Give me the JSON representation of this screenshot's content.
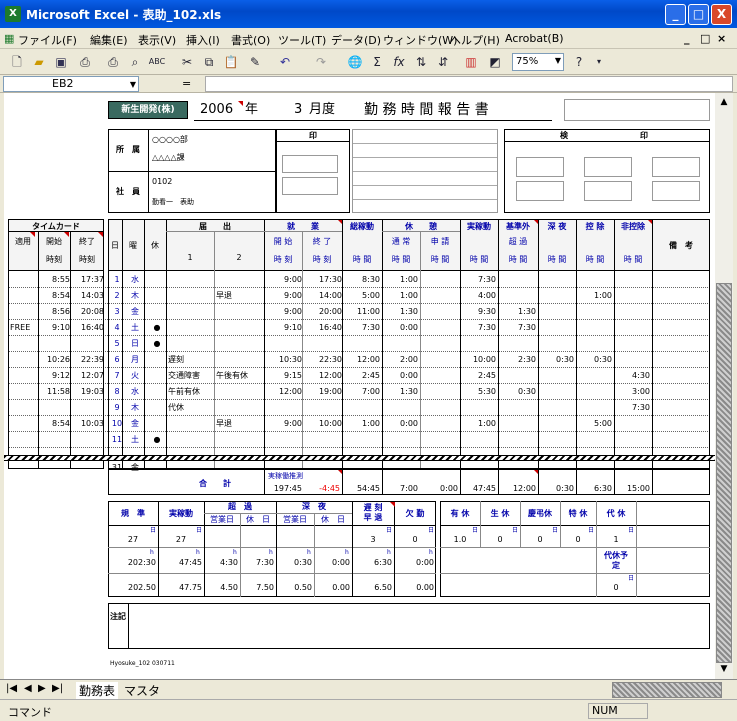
{
  "window": {
    "title": "Microsoft Excel - 表助_102.xls",
    "app_icon": "excel-icon",
    "minimize": "_",
    "maximize": "□",
    "close": "X"
  },
  "menu": [
    "ファイル(F)",
    "編集(E)",
    "表示(V)",
    "挿入(I)",
    "書式(O)",
    "ツール(T)",
    "データ(D)",
    "ウィンドウ(W)",
    "ヘルプ(H)",
    "Acrobat(B)"
  ],
  "doc_controls": {
    "minimize": "_",
    "restore": "□",
    "close": "×"
  },
  "toolbar": {
    "zoom": "75%",
    "sigma": "Σ",
    "fx": "fx",
    "help": "?"
  },
  "formula_bar": {
    "name_box": "EB2",
    "equals": "=",
    "formula": ""
  },
  "report": {
    "company": "新生開発(株)",
    "year": "2006",
    "year_unit": "年",
    "month": "3",
    "month_unit": "月度",
    "title": "勤 務 時 間 報 告 書",
    "dept_label": "所　属",
    "dept1": "○○○○部",
    "dept2": "△△△△課",
    "emp_label": "社　員",
    "emp_no": "0102",
    "emp_name": "勤看一　表助",
    "seal_label": "印",
    "approval_left": "検",
    "approval_right": "印"
  },
  "headers": {
    "timecard": "タイムカード",
    "tc_use": "適用",
    "tc_start": "開始",
    "tc_end": "終了",
    "tc_time": "時刻",
    "day": "日",
    "weekday": "曜",
    "holiday": "休",
    "todoke": "届　　出",
    "todoke1": "1",
    "todoke2": "2",
    "shugyo": "就　　業",
    "start": "開 始",
    "end": "終 了",
    "jikoku": "時 刻",
    "sorokin": "総稼動",
    "kyukei": "休　　憩",
    "tsujo": "通 常",
    "shinsei": "申 請",
    "jisshitsu": "実稼動",
    "kijungai": "基準外",
    "choka": "超 過",
    "shinya": "深 夜",
    "kojo": "控 除",
    "hikojo": "非控除",
    "jikan": "時 間",
    "biko": "備　考"
  },
  "rows": [
    {
      "tc_use": "",
      "tc_start": "8:55",
      "tc_end": "17:37",
      "day": "1",
      "wd": "水",
      "hol": "",
      "t1": "",
      "t2": "",
      "start": "9:00",
      "end": "17:30",
      "total": "8:30",
      "rest": "1:00",
      "req": "",
      "actual": "7:30",
      "over": "",
      "night": "",
      "ded": "",
      "nonded": ""
    },
    {
      "tc_use": "",
      "tc_start": "8:54",
      "tc_end": "14:03",
      "day": "2",
      "wd": "木",
      "hol": "",
      "t1": "",
      "t2": "早退",
      "start": "9:00",
      "end": "14:00",
      "total": "5:00",
      "rest": "1:00",
      "req": "",
      "actual": "4:00",
      "over": "",
      "night": "",
      "ded": "1:00",
      "nonded": ""
    },
    {
      "tc_use": "",
      "tc_start": "8:56",
      "tc_end": "20:08",
      "day": "3",
      "wd": "金",
      "hol": "",
      "t1": "",
      "t2": "",
      "start": "9:00",
      "end": "20:00",
      "total": "11:00",
      "rest": "1:30",
      "req": "",
      "actual": "9:30",
      "over": "1:30",
      "night": "",
      "ded": "",
      "nonded": ""
    },
    {
      "tc_use": "FREE",
      "tc_start": "9:10",
      "tc_end": "16:40",
      "day": "4",
      "wd": "土",
      "hol": "●",
      "t1": "",
      "t2": "",
      "start": "9:10",
      "end": "16:40",
      "total": "7:30",
      "rest": "0:00",
      "req": "",
      "actual": "7:30",
      "over": "7:30",
      "night": "",
      "ded": "",
      "nonded": ""
    },
    {
      "tc_use": "",
      "tc_start": "",
      "tc_end": "",
      "day": "5",
      "wd": "日",
      "hol": "●",
      "t1": "",
      "t2": "",
      "start": "",
      "end": "",
      "total": "",
      "rest": "",
      "req": "",
      "actual": "",
      "over": "",
      "night": "",
      "ded": "",
      "nonded": ""
    },
    {
      "tc_use": "",
      "tc_start": "10:26",
      "tc_end": "22:39",
      "day": "6",
      "wd": "月",
      "hol": "",
      "t1": "遅刻",
      "t2": "",
      "start": "10:30",
      "end": "22:30",
      "total": "12:00",
      "rest": "2:00",
      "req": "",
      "actual": "10:00",
      "over": "2:30",
      "night": "0:30",
      "ded": "0:30",
      "nonded": ""
    },
    {
      "tc_use": "",
      "tc_start": "9:12",
      "tc_end": "12:07",
      "day": "7",
      "wd": "火",
      "hol": "",
      "t1": "交通障害",
      "t2": "午後有休",
      "start": "9:15",
      "end": "12:00",
      "total": "2:45",
      "rest": "0:00",
      "req": "",
      "actual": "2:45",
      "over": "",
      "night": "",
      "ded": "",
      "nonded": "4:30"
    },
    {
      "tc_use": "",
      "tc_start": "11:58",
      "tc_end": "19:03",
      "day": "8",
      "wd": "水",
      "hol": "",
      "t1": "午前有休",
      "t2": "",
      "start": "12:00",
      "end": "19:00",
      "total": "7:00",
      "rest": "1:30",
      "req": "",
      "actual": "5:30",
      "over": "0:30",
      "night": "",
      "ded": "",
      "nonded": "3:00"
    },
    {
      "tc_use": "",
      "tc_start": "",
      "tc_end": "",
      "day": "9",
      "wd": "木",
      "hol": "",
      "t1": "代休",
      "t2": "",
      "start": "",
      "end": "",
      "total": "",
      "rest": "",
      "req": "",
      "actual": "",
      "over": "",
      "night": "",
      "ded": "",
      "nonded": "7:30"
    },
    {
      "tc_use": "",
      "tc_start": "8:54",
      "tc_end": "10:03",
      "day": "10",
      "wd": "金",
      "hol": "",
      "t1": "",
      "t2": "早退",
      "start": "9:00",
      "end": "10:00",
      "total": "1:00",
      "rest": "0:00",
      "req": "",
      "actual": "1:00",
      "over": "",
      "night": "",
      "ded": "5:00",
      "nonded": ""
    },
    {
      "tc_use": "",
      "tc_start": "",
      "tc_end": "",
      "day": "11",
      "wd": "土",
      "hol": "●",
      "t1": "",
      "t2": "",
      "start": "",
      "end": "",
      "total": "",
      "rest": "",
      "req": "",
      "actual": "",
      "over": "",
      "night": "",
      "ded": "",
      "nonded": ""
    },
    {
      "tc_use": "",
      "tc_start": "",
      "tc_end": "",
      "day": "31",
      "wd": "金",
      "hol": "",
      "t1": "",
      "t2": "",
      "start": "",
      "end": "",
      "total": "",
      "rest": "",
      "req": "",
      "actual": "",
      "over": "",
      "night": "",
      "ded": "",
      "nonded": ""
    }
  ],
  "totals": {
    "label": "合　　計",
    "forecast_label": "実稼働推測",
    "forecast": "197:45",
    "diff": "-4:45",
    "total": "54:45",
    "rest": "7:00",
    "req": "0:00",
    "actual": "47:45",
    "over": "12:00",
    "night": "0:30",
    "ded": "6:30",
    "nonded": "15:00"
  },
  "summary": {
    "kijun": "規　準",
    "jisshitsu": "実稼動",
    "choka": "超　過",
    "eigyo": "営業日",
    "kyujitsu": "休　日",
    "shinya": "深　夜",
    "chikoku": "遅 刻",
    "soutai": "早 退",
    "kekkin": "欠 勤",
    "unit_day": "日",
    "unit_hour": "h",
    "days_kijun": "27",
    "days_actual": "27",
    "days_late": "3",
    "days_absent": "0",
    "h_kijun": "202:30",
    "h_actual": "47:45",
    "h_over_work": "4:30",
    "h_over_hol": "7:30",
    "h_night_work": "0:30",
    "h_night_hol": "0:00",
    "h_late": "6:30",
    "h_absent": "0:00",
    "d_kijun": "202.50",
    "d_actual": "47.75",
    "d_over_work": "4.50",
    "d_over_hol": "7.50",
    "d_night_work": "0.50",
    "d_night_hol": "0.00",
    "d_late": "6.50",
    "d_absent": "0.00",
    "yukyu": "有 休",
    "seikyu": "生 休",
    "keicho": "慶弔休",
    "tokkyu": "特 休",
    "daikyu": "代 休",
    "v_yukyu": "1.0",
    "v_seikyu": "0",
    "v_keicho": "0",
    "v_tokkyu": "0",
    "v_daikyu": "1",
    "daikyu_yotei": "代休予定",
    "v_daikyu_yotei": "0"
  },
  "notes_label": "注記",
  "footer": "Hyosuke_102 030711",
  "sheet_tabs": [
    "勤務表",
    "マスタ"
  ],
  "status": {
    "left": "コマンド",
    "num": "NUM"
  }
}
